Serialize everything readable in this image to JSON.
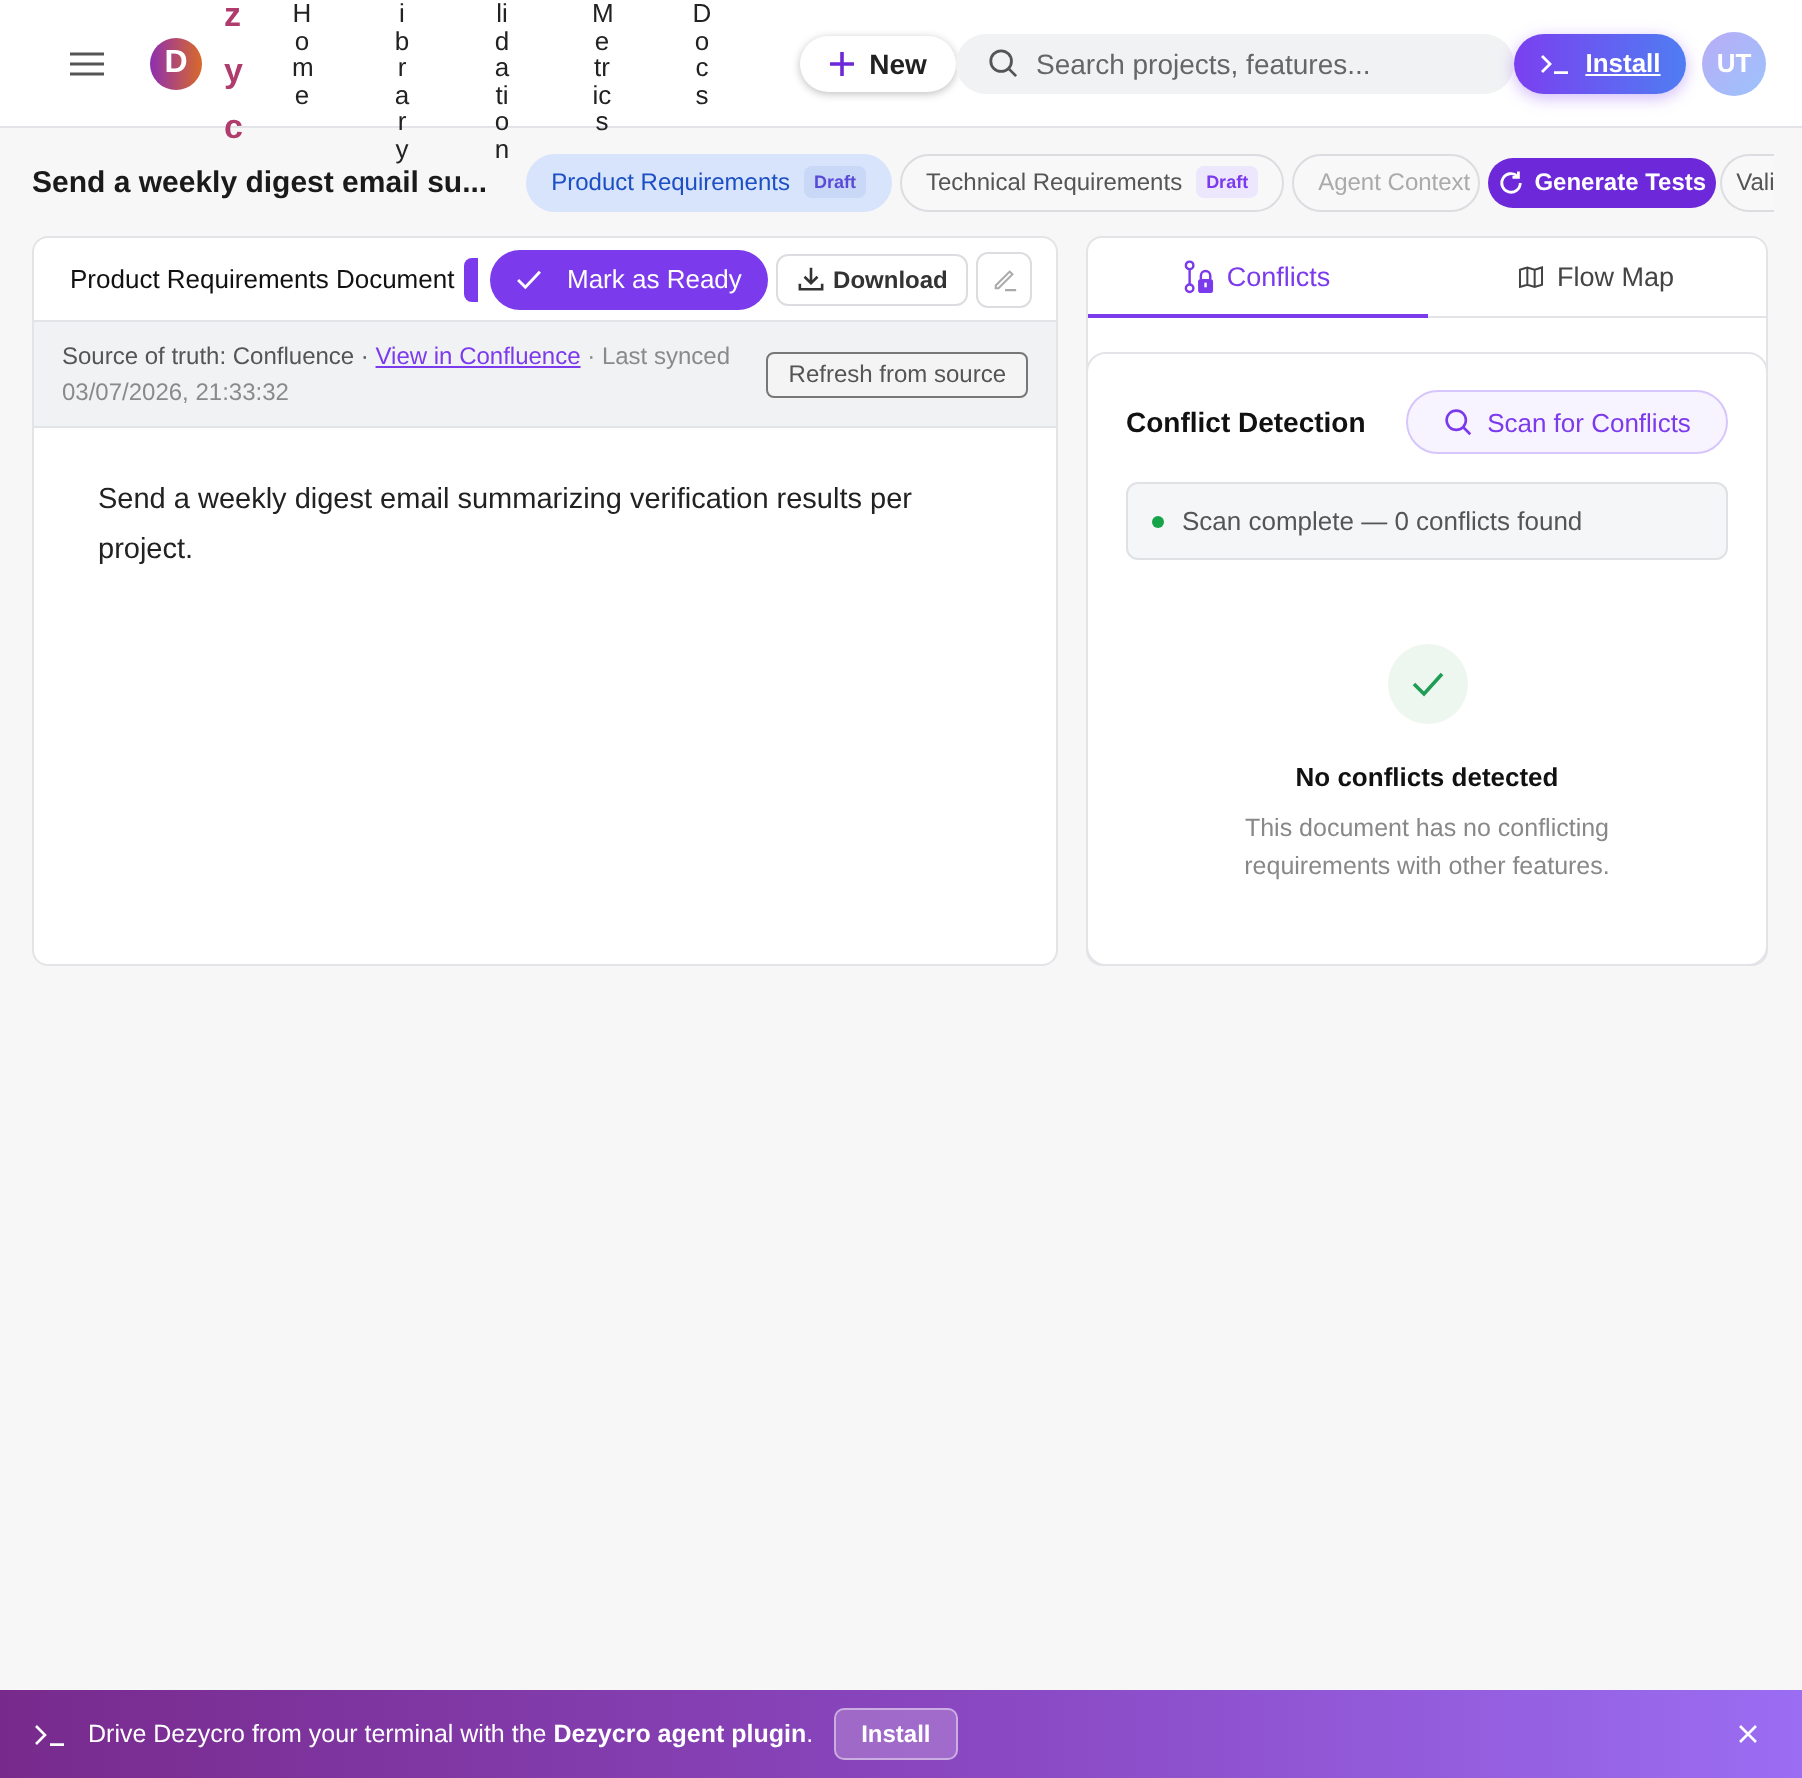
{
  "header": {
    "logo_letter": "D",
    "logo_text": "zyc",
    "nav": [
      {
        "label": "Home"
      },
      {
        "label": "ibrary"
      },
      {
        "label": "lidation"
      },
      {
        "label": "Metrics"
      },
      {
        "label": "Docs"
      }
    ],
    "new_button": "New",
    "search": {
      "placeholder": "Search projects, features..."
    },
    "install_button": "Install",
    "avatar": "UT"
  },
  "feature": {
    "title": "Send a weekly digest email su...",
    "tabs": [
      {
        "label": "Product Requirements",
        "badge": "Draft",
        "selected": true,
        "disabled": false
      },
      {
        "label": "Technical Requirements",
        "badge": "Draft",
        "selected": false,
        "disabled": false
      },
      {
        "label": "Agent Context",
        "selected": false,
        "disabled": true
      },
      {
        "label": "Vali",
        "selected": false,
        "disabled": false
      }
    ],
    "generate_button": "Generate Tests"
  },
  "document": {
    "title": "Product Requirements Document",
    "ready_button": "Mark as Ready",
    "download_button": "Download",
    "source_label": "Source of truth: Confluence ·",
    "source_link": "View in Confluence",
    "synced": "· Last synced 03/07/2026, 21:33:32",
    "refresh_button": "Refresh from source",
    "body": "Send a weekly digest email summarizing verification results per project."
  },
  "side_panel": {
    "tabs": [
      {
        "label": "Conflicts",
        "kind": "conflicts",
        "selected": true
      },
      {
        "label": "Flow Map",
        "kind": "map",
        "selected": false
      }
    ],
    "heading": "Conflict Detection",
    "scan_button": "Scan for Conflicts",
    "status": "Scan complete — 0 conflicts found",
    "empty_title": "No conflicts detected",
    "empty_text": "This document has no conflicting requirements with other features."
  },
  "banner": {
    "text": "Drive Dezycro from your terminal with the **Dezycro agent plugin**.",
    "install_button": "Install"
  }
}
